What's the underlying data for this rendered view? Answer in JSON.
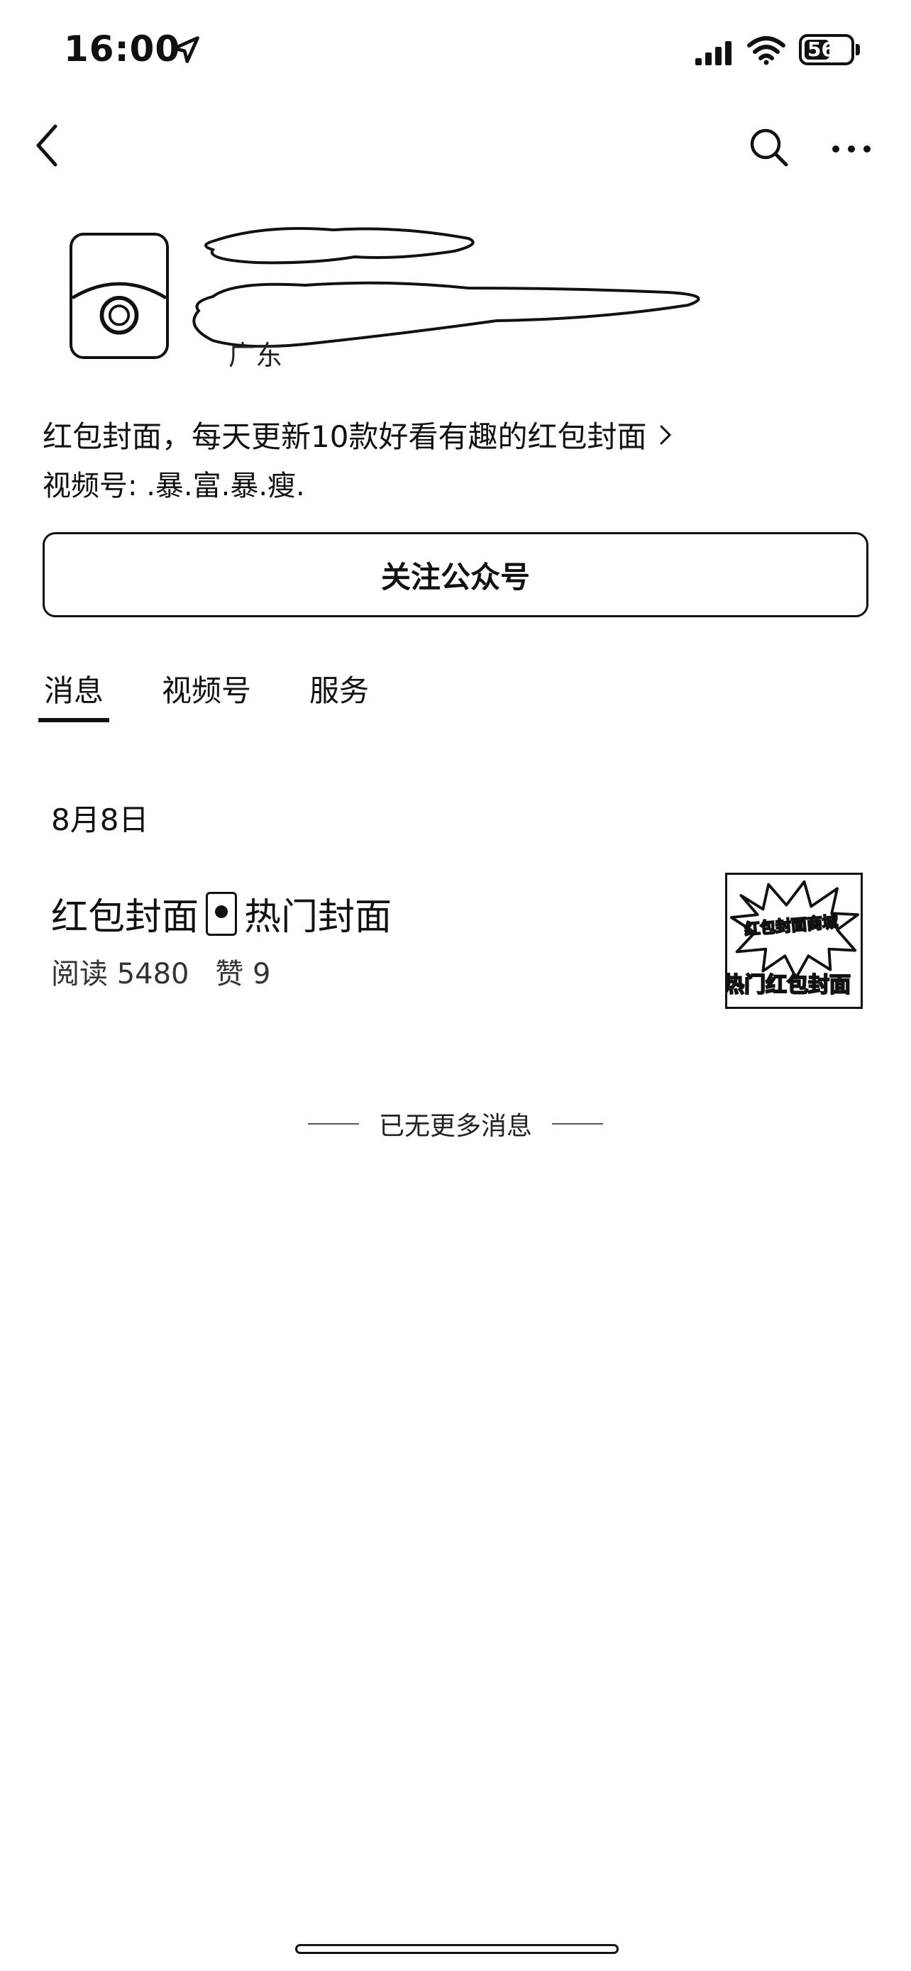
{
  "status": {
    "time": "16:00",
    "battery": "56",
    "battery_level": 0.56
  },
  "profile": {
    "region": "广东",
    "description": "红包封面，每天更新10款好看有趣的红包封面",
    "channel": "视频号: .暴.富.暴.瘦."
  },
  "actions": {
    "follow_label": "关注公众号"
  },
  "tabs": [
    {
      "label": "消息",
      "active": true
    },
    {
      "label": "视频号",
      "active": false
    },
    {
      "label": "服务",
      "active": false
    }
  ],
  "feed": {
    "date": "8月8日",
    "articles": [
      {
        "title_prefix": "红包封面",
        "title_suffix": "热门封面",
        "reads": "阅读 5480",
        "likes": "赞 9",
        "thumb_text_top": "红包封面商城",
        "thumb_text_bottom": "热门红包封面"
      }
    ],
    "end_text": "已无更多消息"
  },
  "colors": {
    "text": "#111111",
    "background": "#ffffff"
  }
}
